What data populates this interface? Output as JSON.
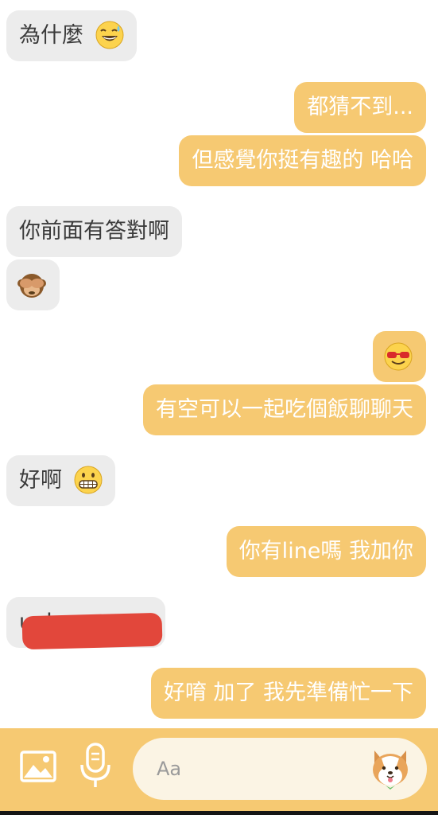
{
  "messages": [
    {
      "side": "in",
      "text": "為什麼",
      "emoji": "grinning-sweat-face"
    },
    {
      "side": "out",
      "text": "都猜不到..."
    },
    {
      "side": "out",
      "text": "但感覺你挺有趣的 哈哈"
    },
    {
      "side": "in",
      "text": "你前面有答對啊"
    },
    {
      "side": "in",
      "text": "",
      "emoji": "see-no-evil-monkey"
    },
    {
      "side": "out",
      "text": "",
      "emoji": "face-with-red-sunglasses"
    },
    {
      "side": "out",
      "text": "有空可以一起吃個飯聊聊天"
    },
    {
      "side": "in",
      "text": "好啊",
      "emoji": "grimacing-face"
    },
    {
      "side": "out",
      "text": "你有line嗎 我加你"
    },
    {
      "side": "in",
      "text": "unh",
      "redacted": true
    },
    {
      "side": "out",
      "text": "好唷 加了 我先準備忙一下"
    }
  ],
  "composer": {
    "placeholder": "Aa",
    "icons": [
      "image-icon",
      "microphone-icon",
      "shiba-sticker-icon"
    ]
  },
  "colors": {
    "outgoing_bubble": "#f6c972",
    "incoming_bubble": "#ececec",
    "composer_bar": "#f6c972",
    "redaction": "#e2473b"
  }
}
